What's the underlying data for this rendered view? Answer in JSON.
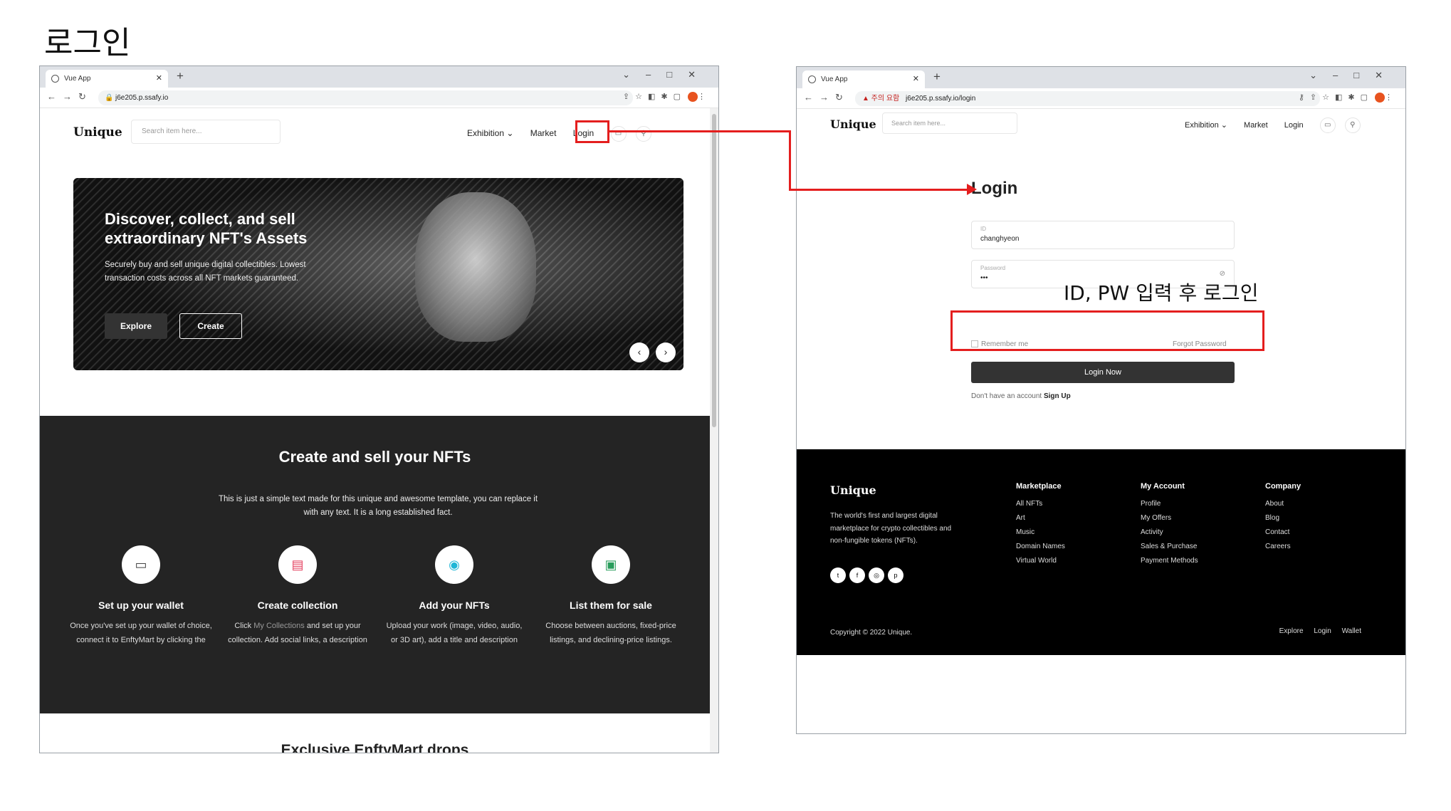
{
  "slide": {
    "title": "로그인",
    "annotation": "ID, PW 입력 후 로그인"
  },
  "browser1": {
    "tab_title": "Vue App",
    "url": "j6e205.p.ssafy.io"
  },
  "browser2": {
    "tab_title": "Vue App",
    "url_warning": "▲ 주의 요함",
    "url": "j6e205.p.ssafy.io/login"
  },
  "site": {
    "logo": "Unique",
    "search_placeholder": "Search item here...",
    "nav": {
      "exhibition": "Exhibition ⌄",
      "market": "Market",
      "login": "Login"
    }
  },
  "hero": {
    "title": "Discover, collect, and sell extraordinary NFT's Assets",
    "subtitle": "Securely buy and sell unique digital collectibles. Lowest transaction costs across all NFT markets guaranteed.",
    "explore_label": "Explore",
    "create_label": "Create",
    "prev": "‹",
    "next": "›"
  },
  "create_section": {
    "title": "Create and sell your NFTs",
    "intro": "This is just a simple text made for this unique and awesome template, you can replace it with any text. It is a long established fact.",
    "features": [
      {
        "icon": "wallet-icon",
        "title": "Set up your wallet",
        "text": "Once you've set up your wallet of choice, connect it to EnftyMart by clicking the"
      },
      {
        "icon": "file-icon",
        "title": "Create collection",
        "text_pre": "Click ",
        "text_link": "My Collections",
        "text_post": " and set up your collection. Add social links, a description"
      },
      {
        "icon": "camera-icon",
        "title": "Add your NFTs",
        "text": "Upload your work (image, video, audio, or 3D art), add a title and description"
      },
      {
        "icon": "cash-icon",
        "title": "List them for sale",
        "text": "Choose between auctions, fixed-price listings, and declining-price listings."
      }
    ],
    "next_heading": "Exclusive EnftyMart drops"
  },
  "login_page": {
    "title": "Login",
    "id_label": "ID",
    "id_value": "changhyeon",
    "pw_label": "Password",
    "pw_value": "•••",
    "remember": "Remember me",
    "forgot": "Forgot Password",
    "login_button": "Login Now",
    "signup_prompt": "Don't have an account",
    "signup_link": "Sign Up"
  },
  "footer": {
    "logo": "Unique",
    "description": "The world's first and largest digital marketplace for crypto collectibles and non-fungible tokens (NFTs).",
    "socials": [
      "twitter-icon",
      "facebook-icon",
      "instagram-icon",
      "pinterest-icon"
    ],
    "marketplace": {
      "title": "Marketplace",
      "items": [
        "All NFTs",
        "Art",
        "Music",
        "Domain Names",
        "Virtual World"
      ]
    },
    "account": {
      "title": "My Account",
      "items": [
        "Profile",
        "My Offers",
        "Activity",
        "Sales & Purchase",
        "Payment Methods"
      ]
    },
    "company": {
      "title": "Company",
      "items": [
        "About",
        "Blog",
        "Contact",
        "Careers"
      ]
    },
    "copyright": "Copyright © 2022 Unique.",
    "links": [
      "Explore",
      "Login",
      "Wallet"
    ]
  },
  "colors": {
    "highlight": "#e41e1e",
    "dark_section": "#242424",
    "footer": "#000000",
    "button": "#333333"
  }
}
